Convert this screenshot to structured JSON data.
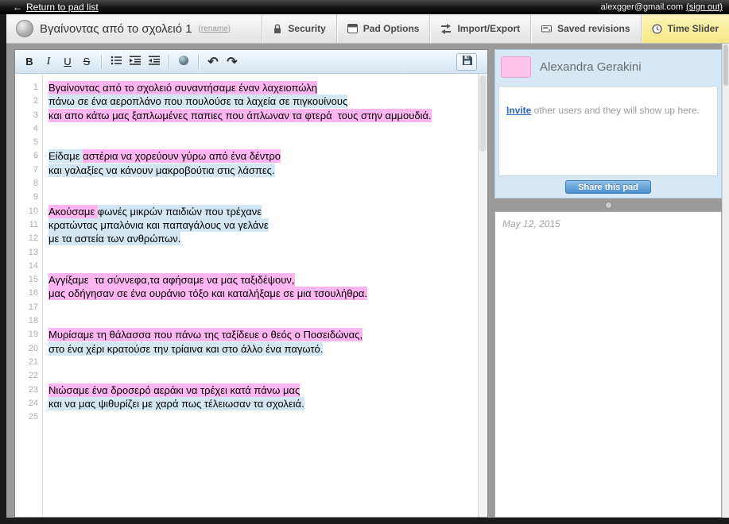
{
  "topbar": {
    "back_arrow_glyph": "←",
    "return_link_label": "Return to pad list",
    "account_email": "alexgger@gmail.com",
    "signout_label": "(sign out)"
  },
  "titlebar": {
    "pad_title": "Βγαίνοντας από το σχολειό 1",
    "rename_label": "(rename)",
    "buttons": {
      "security": "Security",
      "pad_options": "Pad Options",
      "import_export": "Import/Export",
      "saved_revisions": "Saved revisions",
      "time_slider": "Time Slider"
    }
  },
  "toolbar": {
    "bold_label": "B",
    "italic_label": "I",
    "underline_label": "U",
    "strikethrough_label": "S",
    "undo_glyph": "↶",
    "redo_glyph": "↷"
  },
  "editor": {
    "author_colors": {
      "pink": "#ffb5f2",
      "blue": "#d3e6f4"
    },
    "lines": [
      {
        "n": 1,
        "segments": [
          {
            "text": "Βγαίνοντας από το σχολειό συναντήσαμε έναν λαχειοπώλη",
            "hl": "pink"
          }
        ]
      },
      {
        "n": 2,
        "segments": [
          {
            "text": "πάνω σε ένα αεροπλάνο που πουλούσε τα λαχεία σε πιγκουίνους",
            "hl": "blue"
          }
        ]
      },
      {
        "n": 3,
        "segments": [
          {
            "text": "και απο κάτω μας ξαπλωμένες παπιες που άπλωναν τα φτερά  τους στην αμμουδιά.",
            "hl": "pink"
          }
        ]
      },
      {
        "n": 4,
        "segments": []
      },
      {
        "n": 5,
        "segments": []
      },
      {
        "n": 6,
        "segments": [
          {
            "text": "Είδαμε ",
            "hl": "blue"
          },
          {
            "text": "αστέρια να χορεύουν γύρω από ένα δέντρο",
            "hl": "pink"
          }
        ]
      },
      {
        "n": 7,
        "segments": [
          {
            "text": "και γαλαξίες να κάνουν μακροβούτια στις λάσπες.",
            "hl": "blue"
          }
        ]
      },
      {
        "n": 8,
        "segments": []
      },
      {
        "n": 9,
        "segments": []
      },
      {
        "n": 10,
        "segments": [
          {
            "text": "Ακούσαμε ",
            "hl": "pink"
          },
          {
            "text": "φωνές μικρών παιδιών που τρέχανε",
            "hl": "blue"
          }
        ]
      },
      {
        "n": 11,
        "segments": [
          {
            "text": "κρατώντας μπαλόνια και παπαγάλους να γελάνε",
            "hl": "blue"
          }
        ]
      },
      {
        "n": 12,
        "segments": [
          {
            "text": "με τα αστεία των ανθρώπων.",
            "hl": "blue"
          }
        ]
      },
      {
        "n": 13,
        "segments": []
      },
      {
        "n": 14,
        "segments": []
      },
      {
        "n": 15,
        "segments": [
          {
            "text": "Αγγίξαμε  τα σύννεφα,τα αφήσαμε να μας ταξιδέψουν,",
            "hl": "pink"
          }
        ]
      },
      {
        "n": 16,
        "segments": [
          {
            "text": "μας οδήγησαν σε ένα ουράνιο τόξο και καταλήξαμε σε μια τσουλήθρα.",
            "hl": "pink"
          }
        ]
      },
      {
        "n": 17,
        "segments": []
      },
      {
        "n": 18,
        "segments": []
      },
      {
        "n": 19,
        "segments": [
          {
            "text": "Μυρίσαμε τη θάλασσα που πάνω της ταξίδευε ο θεός ο Ποσειδώνας,",
            "hl": "pink"
          }
        ]
      },
      {
        "n": 20,
        "segments": [
          {
            "text": "στο ένα χέρι κρατούσε την τρίαινα και στο άλλο ένα παγωτό.",
            "hl": "blue"
          }
        ]
      },
      {
        "n": 21,
        "segments": []
      },
      {
        "n": 22,
        "segments": []
      },
      {
        "n": 23,
        "segments": [
          {
            "text": "Νιώσαμε ένα δροσερό αεράκι να τρέχει κατά πάνω μας",
            "hl": "pink"
          }
        ]
      },
      {
        "n": 24,
        "segments": [
          {
            "text": "και να μας ψιθυρίζει με χαρά πως τέλειωσαν τα σχολειά.",
            "hl": "blue"
          }
        ]
      },
      {
        "n": 25,
        "segments": []
      }
    ]
  },
  "sidebar": {
    "user_name": "Alexandra Gerakini",
    "avatar_color": "#ffc3ec",
    "invite_link_label": "Invite",
    "invite_text": " other users and they will show up here.",
    "share_button_label": "Share this pad"
  },
  "chat": {
    "date_label": "May 12, 2015"
  },
  "colors": {
    "time_slider_highlight": "#f9ee9f",
    "share_button_blue": "#4a8fce",
    "workspace_background": "#9a9a9a"
  }
}
